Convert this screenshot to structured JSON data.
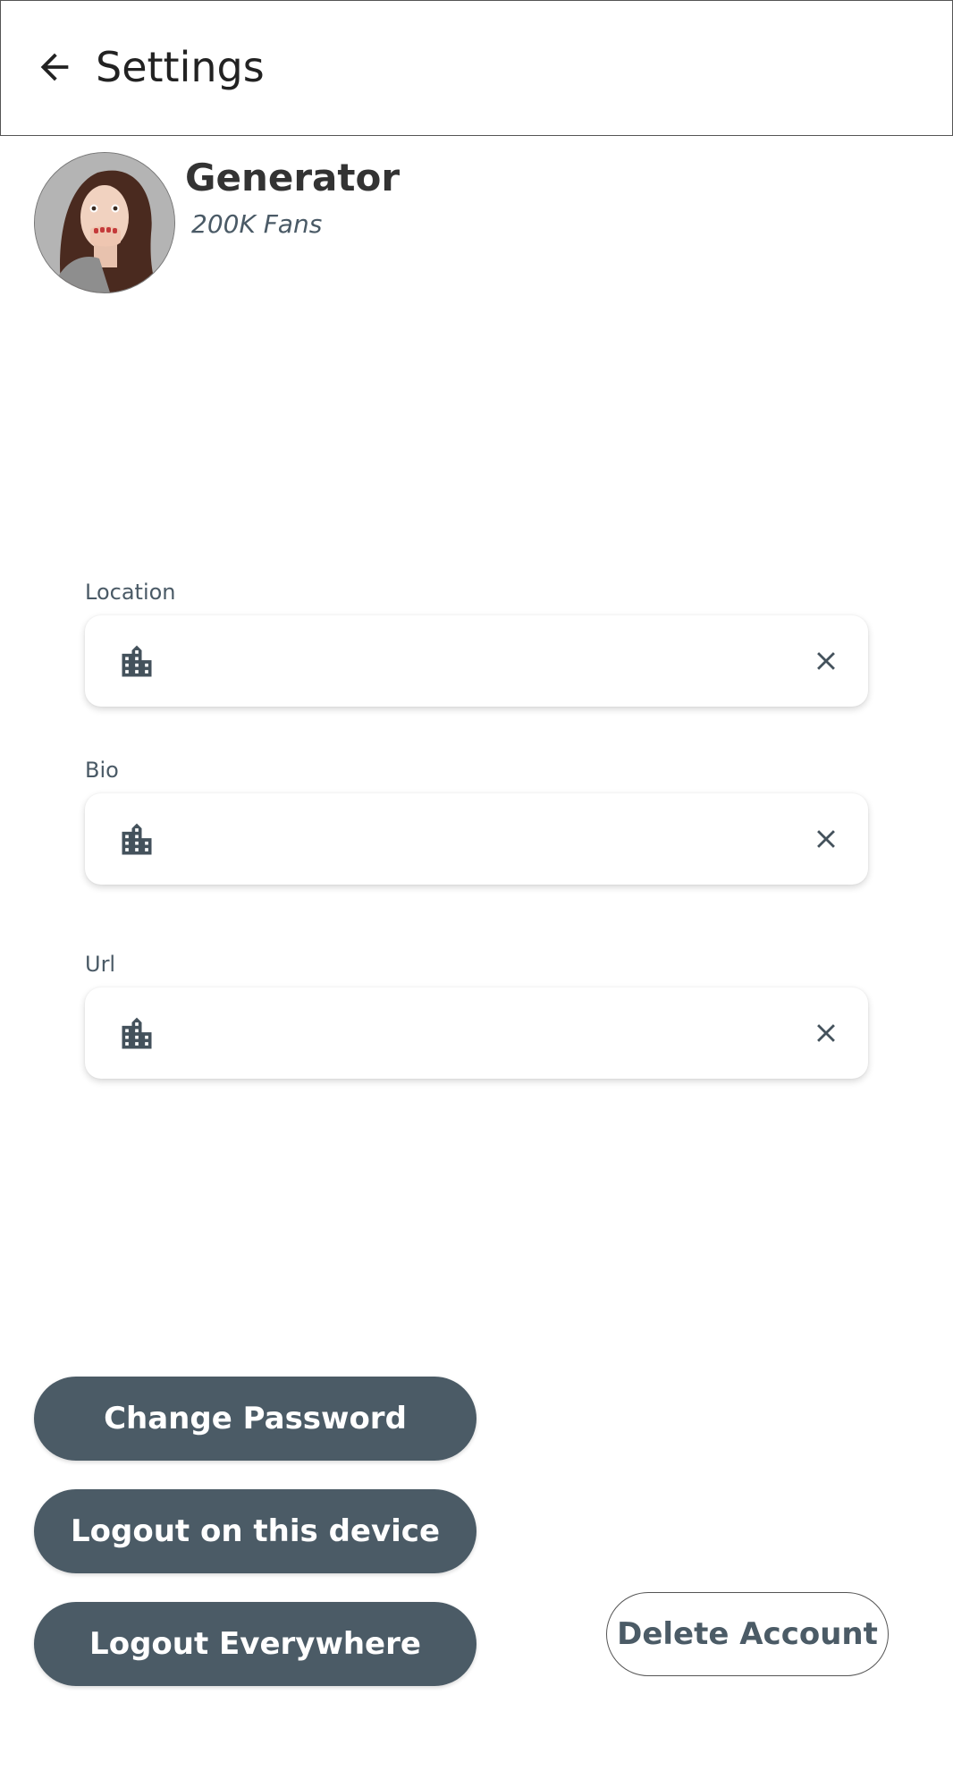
{
  "header": {
    "title": "Settings",
    "back_icon": "arrow-left-icon"
  },
  "profile": {
    "name": "Generator",
    "fans": "200K Fans",
    "avatar_icon": "avatar-photo"
  },
  "fields": [
    {
      "label": "Location",
      "value": "",
      "icon": "building-icon",
      "clear_icon": "close-icon"
    },
    {
      "label": "Bio",
      "value": "",
      "icon": "building-icon",
      "clear_icon": "close-icon"
    },
    {
      "label": "Url",
      "value": "",
      "icon": "building-icon",
      "clear_icon": "close-icon"
    }
  ],
  "actions": {
    "change_password": "Change Password",
    "logout_device": "Logout on this device",
    "logout_everywhere": "Logout Everywhere",
    "delete_account": "Delete Account"
  },
  "colors": {
    "primary_button": "#4b5b66",
    "icon": "#44525c",
    "text": "#2f3b42"
  }
}
